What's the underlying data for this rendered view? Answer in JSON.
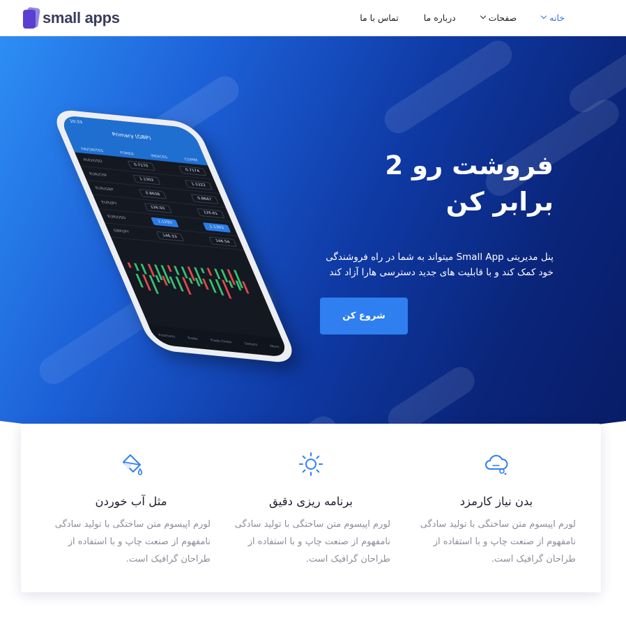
{
  "brand": {
    "logo_text": "small apps",
    "logo_icon": "stacked-cards-icon"
  },
  "nav": {
    "items": [
      {
        "label": "خانه",
        "has_dropdown": true,
        "active": true
      },
      {
        "label": "صفحات",
        "has_dropdown": true,
        "active": false
      },
      {
        "label": "درباره ما",
        "has_dropdown": false,
        "active": false
      },
      {
        "label": "تماس با ما",
        "has_dropdown": false,
        "active": false
      }
    ]
  },
  "hero": {
    "title": "فروشت رو 2 برابر کن",
    "subtitle": "پنل مدیریتی Small App میتواند به شما در راه فروشندگی خود کمک کند و با قابلیت های جدید دسترسی هارا آزاد کند",
    "cta_label": "شروع کن",
    "phone": {
      "time": "10:33",
      "header_title": "Primary (GBP)",
      "tabs": [
        "FAVORITES",
        "FOREX",
        "INDICES",
        "COMM"
      ],
      "rows": [
        {
          "pair": "AUD/USD",
          "bid": "0.7170",
          "ask": "0.7174"
        },
        {
          "pair": "EUR/CHF",
          "bid": "1.1302",
          "ask": "1.1322"
        },
        {
          "pair": "EUR/GBP",
          "bid": "0.8638",
          "ask": "0.8647"
        },
        {
          "pair": "EUR/JPY",
          "bid": "126.50",
          "ask": "126.61"
        },
        {
          "pair": "GBP/JPY",
          "bid": "146.33",
          "ask": "146.54"
        }
      ],
      "selected": {
        "pair": "EUR/USD",
        "bid": "1.1293",
        "ask": "1.1303"
      },
      "footer": [
        "Positions",
        "Trade",
        "Trade Order",
        "Details",
        "More"
      ]
    }
  },
  "features": [
    {
      "icon": "cloud-icon",
      "title": "بدن نیاز کارمزد",
      "description": "لورم اپیسوم متن ساختگی با تولید سادگی نامفهوم از صنعت چاپ و با استفاده از طراحان گرافیک است."
    },
    {
      "icon": "sun-icon",
      "title": "برنامه ریزی دقیق",
      "description": "لورم اپیسوم متن ساختگی با تولید سادگی نامفهوم از صنعت چاپ و با استفاده از طراحان گرافیک است."
    },
    {
      "icon": "paint-bucket-icon",
      "title": "مثل آب خوردن",
      "description": "لورم اپیسوم متن ساختگی با تولید سادگی نامفهوم از صنعت چاپ و با استفاده از طراحان گرافیک است."
    }
  ],
  "colors": {
    "accent": "#2f7ff0",
    "hero_dark": "#0a2478",
    "hero_light": "#2d8ef5",
    "text_muted": "#8a8e99"
  }
}
